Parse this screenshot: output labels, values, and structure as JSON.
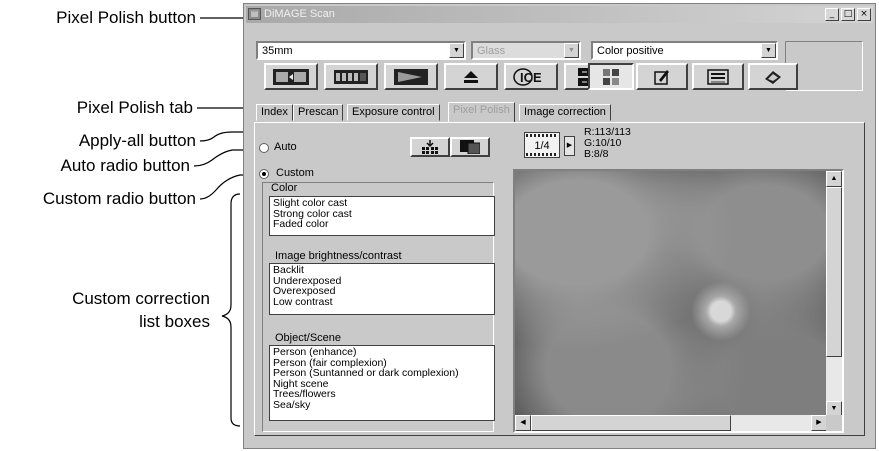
{
  "callouts": {
    "pixel_polish_button": "Pixel Polish button",
    "pixel_polish_tab": "Pixel Polish tab",
    "apply_all_button": "Apply-all button",
    "auto_radio_button": "Auto radio button",
    "custom_radio_button": "Custom radio button",
    "custom_lists_line1": "Custom correction",
    "custom_lists_line2": "list boxes"
  },
  "window": {
    "title": "DiMAGE Scan",
    "minimize_glyph": "_",
    "maximize_glyph": "□",
    "close_glyph": "×"
  },
  "selectors": {
    "film_format": "35mm",
    "film_material": "Glass",
    "film_type": "Color positive",
    "arrow_glyph": "▼"
  },
  "toolbar": {
    "buttons": [
      {
        "icon": "prescan-film-strip-icon"
      },
      {
        "icon": "index-scan-icon"
      },
      {
        "icon": "play-scan-icon"
      },
      {
        "icon": "eject-icon"
      },
      {
        "icon": "ice-icon",
        "label": "ICE"
      },
      {
        "icon": "grain-dissolver-icon"
      },
      {
        "icon": "pixel-polish-icon",
        "pressed": true
      },
      {
        "icon": "preferences-icon"
      },
      {
        "icon": "save-settings-icon"
      },
      {
        "icon": "help-icon"
      }
    ]
  },
  "tabs": [
    {
      "label": "Index",
      "faded": false,
      "active": false
    },
    {
      "label": "Prescan",
      "faded": false,
      "active": false
    },
    {
      "label": "Exposure control",
      "faded": false,
      "active": false
    },
    {
      "label": "Pixel Polish",
      "faded": true,
      "active": true
    },
    {
      "label": "Image correction",
      "faded": false,
      "active": false
    }
  ],
  "pixel_polish": {
    "auto_label": "Auto",
    "custom_label": "Custom",
    "selected_mode": "Custom",
    "color": {
      "heading": "Color",
      "items": [
        "Slight color cast",
        "Strong color cast",
        "Faded color"
      ]
    },
    "brightness": {
      "heading": "Image brightness/contrast",
      "items": [
        "Backlit",
        "Underexposed",
        "Overexposed",
        "Low contrast"
      ]
    },
    "scene": {
      "heading": "Object/Scene",
      "items": [
        "Person (enhance)",
        "Person (fair complexion)",
        "Person (Suntanned or dark complexion)",
        "Night scene",
        "Trees/flowers",
        "Sea/sky"
      ]
    }
  },
  "preview": {
    "frame_counter": "1/4",
    "next_glyph": "▶",
    "r": "R:113/113",
    "g": "G:10/10",
    "b": "B:8/8",
    "up_glyph": "▲",
    "down_glyph": "▼",
    "left_glyph": "◀",
    "right_glyph": "▶"
  }
}
